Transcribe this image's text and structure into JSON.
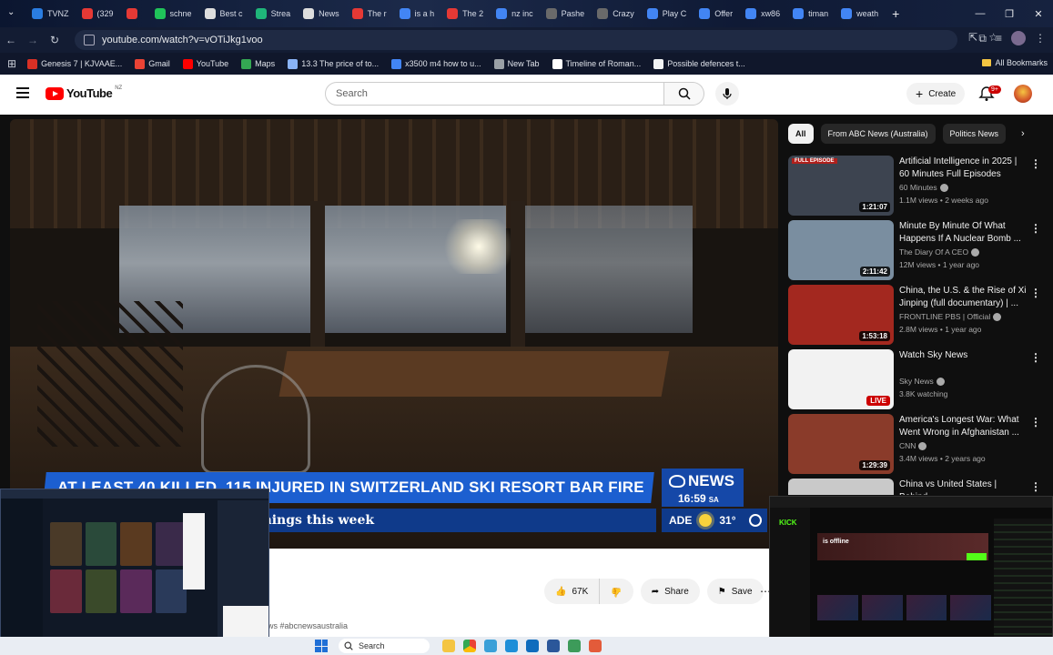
{
  "browser": {
    "tabs": [
      {
        "label": "TVNZ",
        "color": "#2a7de1"
      },
      {
        "label": "(329",
        "color": "#e53935"
      },
      {
        "label": "",
        "color": "#e53935"
      },
      {
        "label": "schne",
        "color": "#20c35a"
      },
      {
        "label": "Best c",
        "color": "#dddddd"
      },
      {
        "label": "Strea",
        "color": "#1fb57a"
      },
      {
        "label": "News",
        "color": "#dddddd"
      },
      {
        "label": "The r",
        "color": "#e53935"
      },
      {
        "label": "is a h",
        "color": "#4285f4"
      },
      {
        "label": "The 2",
        "color": "#e53935"
      },
      {
        "label": "nz inc",
        "color": "#4285f4"
      },
      {
        "label": "Pashe",
        "color": "#6a6a6a"
      },
      {
        "label": "Crazy",
        "color": "#6a6a6a"
      },
      {
        "label": "Play C",
        "color": "#4285f4"
      },
      {
        "label": "Offer",
        "color": "#4285f4"
      },
      {
        "label": "xw86",
        "color": "#4285f4"
      },
      {
        "label": "timan",
        "color": "#4285f4"
      },
      {
        "label": "weath",
        "color": "#4285f4"
      }
    ],
    "new_tab_label": "+",
    "url": "youtube.com/watch?v=vOTiJkg1voo",
    "bookmarks": [
      {
        "label": "Genesis 7 | KJVAAE...",
        "color": "#d93025"
      },
      {
        "label": "Gmail",
        "color": "#ea4335"
      },
      {
        "label": "YouTube",
        "color": "#ff0000"
      },
      {
        "label": "Maps",
        "color": "#34a853"
      },
      {
        "label": "13.3 The price of to...",
        "color": "#8ab4f8"
      },
      {
        "label": "x3500 m4 how to u...",
        "color": "#4285f4"
      },
      {
        "label": "New Tab",
        "color": "#9aa0a6"
      },
      {
        "label": "Timeline of Roman...",
        "color": "#ffffff"
      },
      {
        "label": "Possible defences t...",
        "color": "#f1f3f4"
      }
    ],
    "all_bookmarks_label": "All Bookmarks"
  },
  "youtube": {
    "logo_text": "YouTube",
    "region": "NZ",
    "search_placeholder": "Search",
    "create_label": "Create",
    "notification_count": "9+"
  },
  "video": {
    "headline": "AT LEAST 40 KILLED, 115 INJURED IN SWITZERLAND SKI RESORT BAR FIRE",
    "ticker": "afety plea after spike in drownings this week",
    "network": "NEWS",
    "time": "16:59",
    "time_zone": "SA",
    "weather_city": "ADE",
    "temperature": "31°",
    "like_count": "67K",
    "share_label": "Share",
    "save_label": "Save",
    "hashtag_text": "ws #abcnewsaustralia"
  },
  "chips": [
    {
      "label": "All",
      "active": true
    },
    {
      "label": "From ABC News (Australia)",
      "active": false
    },
    {
      "label": "Politics News",
      "active": false
    }
  ],
  "recommendations": [
    {
      "title": "Artificial Intelligence in 2025 | 60 Minutes Full Episodes",
      "channel": "60 Minutes",
      "meta": "1.1M views • 2 weeks ago",
      "duration": "1:21:07",
      "tag": "FULL EPISODE",
      "thumb": "#3d4450"
    },
    {
      "title": "Minute By Minute Of What Happens If A Nuclear Bomb ...",
      "channel": "The Diary Of A CEO",
      "meta": "12M views • 1 year ago",
      "duration": "2:11:42",
      "tag": "",
      "thumb": "#7a8ea0"
    },
    {
      "title": "China, the U.S. & the Rise of Xi Jinping (full documentary) | ...",
      "channel": "FRONTLINE PBS | Official",
      "meta": "2.8M views • 1 year ago",
      "duration": "1:53:18",
      "tag": "",
      "thumb": "#a3281f"
    },
    {
      "title": "Watch Sky News",
      "channel": "Sky News",
      "meta": "3.8K watching",
      "duration": "LIVE",
      "tag": "",
      "thumb": "#f2f2f2"
    },
    {
      "title": "America's Longest War: What Went Wrong in Afghanistan ...",
      "channel": "CNN",
      "meta": "3.4M views • 2 years ago",
      "duration": "1:29:39",
      "tag": "",
      "thumb": "#8a3b2a"
    },
    {
      "title": "China vs United States | Behind",
      "channel": "",
      "meta": "",
      "duration": "",
      "tag": "",
      "thumb": "#c9c9c9"
    }
  ],
  "overlay_right": {
    "brand": "KICK",
    "status": "is offline"
  },
  "taskbar": {
    "search_label": "Search"
  }
}
